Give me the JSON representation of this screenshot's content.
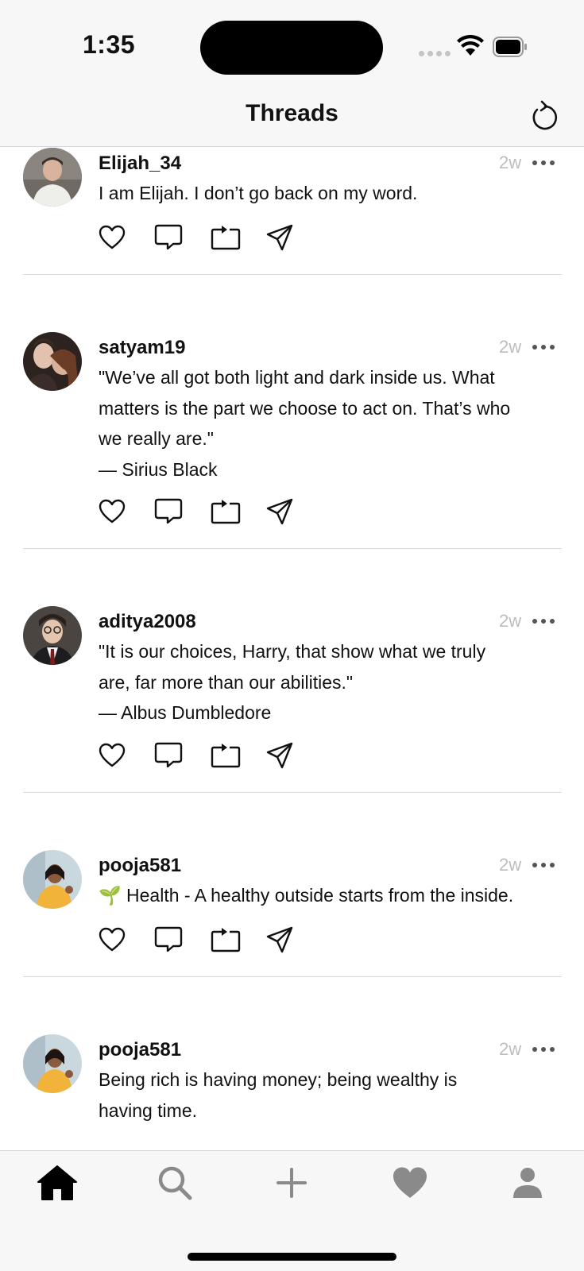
{
  "status_bar": {
    "time": "1:35"
  },
  "nav": {
    "title": "Threads",
    "refresh_icon": "refresh-icon"
  },
  "posts": [
    {
      "username": "Elijah_34",
      "time": "2w",
      "lines": [
        "I am Elijah. I don’t go back on my word."
      ]
    },
    {
      "username": "satyam19",
      "time": "2w",
      "lines": [
        "\"We’ve all got both light and dark inside us. What",
        "matters is the part we choose to act on. That’s who",
        "we really are.\"",
        "— Sirius Black"
      ]
    },
    {
      "username": "aditya2008",
      "time": "2w",
      "lines": [
        "\"It is our choices, Harry, that show what we truly",
        "are, far more than our abilities.\"",
        "— Albus Dumbledore"
      ]
    },
    {
      "username": "pooja581",
      "time": "2w",
      "lines": [
        "🌱 Health - A healthy outside starts from the inside."
      ]
    },
    {
      "username": "pooja581",
      "time": "2w",
      "lines": [
        "Being rich is having money; being wealthy is",
        "having time."
      ]
    }
  ],
  "tabs": [
    {
      "name": "home",
      "icon": "home-icon",
      "active": true
    },
    {
      "name": "search",
      "icon": "search-icon",
      "active": false
    },
    {
      "name": "compose",
      "icon": "plus-icon",
      "active": false
    },
    {
      "name": "activity",
      "icon": "heart-icon",
      "active": false
    },
    {
      "name": "profile",
      "icon": "person-icon",
      "active": false
    }
  ],
  "colors": {
    "text": "#111111",
    "muted": "#bdbdbd",
    "tab_inactive": "#8a8a8a",
    "bar_bg": "#f7f7f7"
  }
}
